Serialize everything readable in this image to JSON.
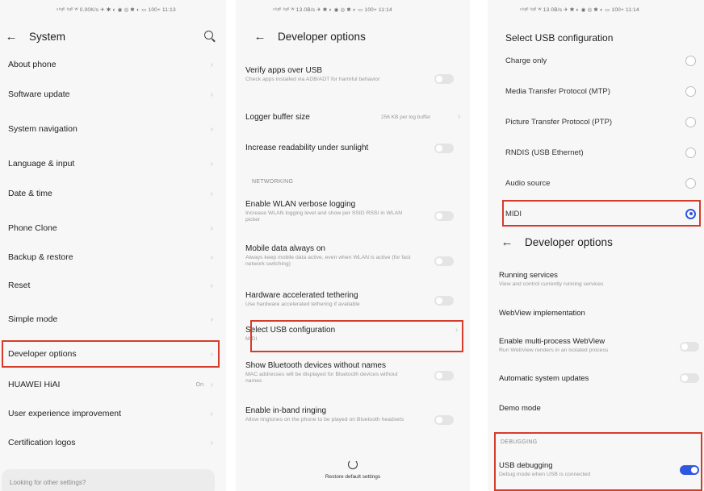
{
  "panel1": {
    "status": "ⁿ⁶ᵍˡˡ ⁶ᵍˡˡ ᵂ 0.00K/s ✈ ✱ ◐   ◉ ◎ ✱ ◐ ▭ 100+ 11:13",
    "title": "System",
    "items": [
      {
        "label": "About phone"
      },
      {
        "label": "Software update"
      },
      {
        "label": "System navigation"
      },
      {
        "label": "Language & input"
      },
      {
        "label": "Date & time"
      },
      {
        "label": "Phone Clone"
      },
      {
        "label": "Backup & restore"
      },
      {
        "label": "Reset"
      },
      {
        "label": "Simple mode"
      },
      {
        "label": "Developer options"
      },
      {
        "label": "HUAWEI HiAI",
        "value": "On"
      },
      {
        "label": "User experience improvement"
      },
      {
        "label": "Certification logos"
      }
    ],
    "search_hint": "Looking for other settings?"
  },
  "panel2": {
    "status": "ⁿ⁶ᵍˡˡ ⁶ᵍˡˡ ᵂ 13.0B/s ✈ ✱ ◐   ◉ ◎ ✱ ◐ ▭ 100+ 11:14",
    "title": "Developer options",
    "verify": {
      "title": "Verify apps over USB",
      "sub": "Check apps installed via ADB/ADT for harmful behavior"
    },
    "logger": {
      "title": "Logger buffer size",
      "value": "256 KB per log buffer"
    },
    "readability": {
      "title": "Increase readability under sunlight"
    },
    "networking_header": "NETWORKING",
    "wlan": {
      "title": "Enable WLAN verbose logging",
      "sub": "Increase WLAN logging level and show per SSID RSSI in WLAN picker"
    },
    "mobile": {
      "title": "Mobile data always on",
      "sub": "Always keep mobile data active, even when WLAN is active (for fast network switching)"
    },
    "tether": {
      "title": "Hardware accelerated tethering",
      "sub": "Use hardware accelerated tethering if available"
    },
    "usbcfg": {
      "title": "Select USB configuration",
      "sub": "MIDI"
    },
    "bt": {
      "title": "Show Bluetooth devices without names",
      "sub": "MAC addresses will be displayed for Bluetooth devices without names"
    },
    "inband": {
      "title": "Enable in-band ringing",
      "sub": "Allow ringtones on the phone to be played on Bluetooth headsets"
    },
    "restore": "Restore default settings"
  },
  "panel3": {
    "status": "ⁿ⁶ᵍˡˡ ⁶ᵍˡˡ ᵂ 13.0B/s ✈ ✱ ◐   ◉ ◎ ✱ ◐ ▭ 100+ 11:14",
    "dialog_title": "Select USB configuration",
    "options": [
      {
        "label": "Charge only",
        "selected": false
      },
      {
        "label": "Media Transfer Protocol (MTP)",
        "selected": false
      },
      {
        "label": "Picture Transfer Protocol (PTP)",
        "selected": false
      },
      {
        "label": "RNDIS (USB Ethernet)",
        "selected": false
      },
      {
        "label": "Audio source",
        "selected": false
      },
      {
        "label": "MIDI",
        "selected": true
      }
    ],
    "title": "Developer options",
    "running": {
      "title": "Running services",
      "sub": "View and control currently running services"
    },
    "webview": {
      "title": "WebView implementation"
    },
    "multiproc": {
      "title": "Enable multi-process WebView",
      "sub": "Run WebView renders in an isolated process"
    },
    "autoupdate": {
      "title": "Automatic system updates"
    },
    "demo": {
      "title": "Demo mode"
    },
    "debug_header": "DEBUGGING",
    "usbdebug": {
      "title": "USB debugging",
      "sub": "Debug mode when USB is connected"
    }
  },
  "colors": {
    "highlight": "#d63c2b",
    "accent": "#2f58e0"
  }
}
